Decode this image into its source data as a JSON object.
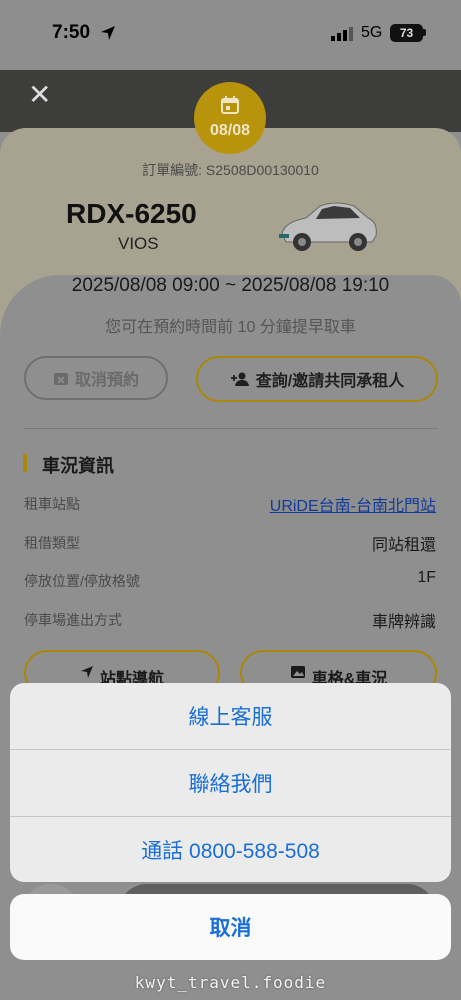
{
  "status_bar": {
    "time": "7:50",
    "network": "5G",
    "battery": "73"
  },
  "header": {
    "close_icon": "close-icon"
  },
  "booking": {
    "date_badge": "08/08",
    "order_number": "訂單編號: S2508D00130010",
    "plate": "RDX-6250",
    "model": "VIOS",
    "time_range": "2025/08/08 09:00 ~ 2025/08/08 19:10",
    "pickup_hint": "您可在預約時間前 10 分鐘提早取車"
  },
  "actions": {
    "cancel_booking": "取消預約",
    "invite_co_renter": "查詢/邀請共同承租人"
  },
  "vehicle_info": {
    "title": "車況資訊",
    "rows": [
      {
        "label": "租車站點",
        "value": "URiDE台南-台南北門站"
      },
      {
        "label": "租借類型",
        "value": "同站租還"
      },
      {
        "label": "停放位置/停放格號",
        "value": "1F"
      },
      {
        "label": "停車場進出方式",
        "value": "車牌辨識"
      }
    ]
  },
  "nav_buttons": {
    "station_nav": "站點導航",
    "spot_status": "車格&車況"
  },
  "action_sheet": {
    "items": [
      "線上客服",
      "聯絡我們",
      "通話 0800-588-508"
    ],
    "cancel": "取消"
  },
  "watermark": "kwyt_travel.foodie",
  "colors": {
    "accent_gold": "#e8b90e",
    "link_blue": "#1a6fd6",
    "header_dark": "#3d3d3c"
  }
}
